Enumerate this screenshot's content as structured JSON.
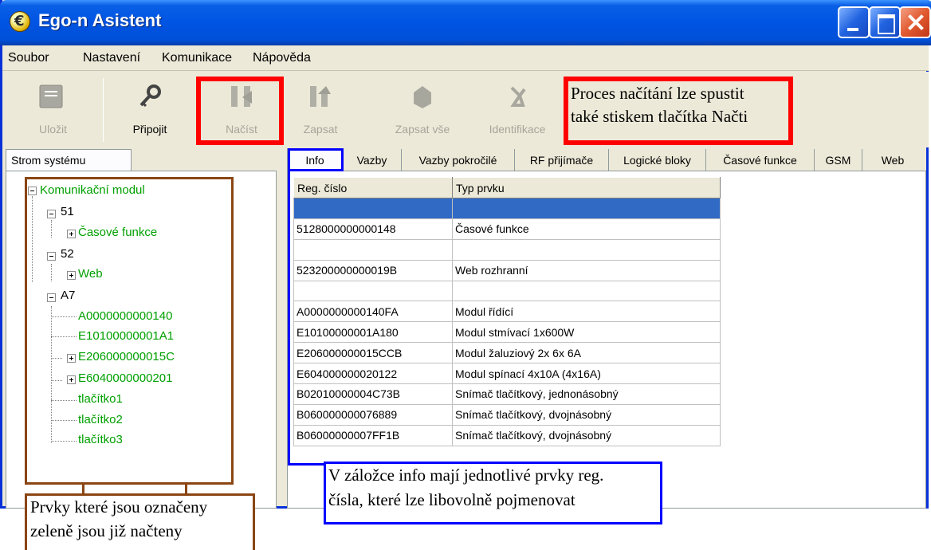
{
  "window": {
    "title": "Ego-n Asistent"
  },
  "menu": {
    "items": [
      "Soubor",
      "Nastavení",
      "Komunikace",
      "Nápověda"
    ]
  },
  "toolbar": {
    "save": "Uložit",
    "connect": "Připojit",
    "read": "Načíst",
    "write": "Zapsat",
    "write_all": "Zapsat vše",
    "identify": "Identifikace"
  },
  "left_tab": "Strom systému",
  "tree": {
    "root": "Komunikační modul",
    "n51": "51",
    "n51_child": "Časové funkce",
    "n52": "52",
    "n52_child": "Web",
    "nA7": "A7",
    "a1": "A0000000000140",
    "a2": "E10100000001A1",
    "a3": "E206000000015C",
    "a4": "E6040000000201",
    "a5": "tlačítko1",
    "a6": "tlačítko2",
    "a7": "tlačítko3"
  },
  "tabs": [
    "Info",
    "Vazby",
    "Vazby pokročilé",
    "RF přijímače",
    "Logické bloky",
    "Časové funkce",
    "GSM",
    "Web"
  ],
  "table": {
    "headers": [
      "Reg. číslo",
      "Typ prvku"
    ],
    "rows": [
      [
        "",
        ""
      ],
      [
        "5128000000000148",
        "Časové funkce"
      ],
      [
        "",
        ""
      ],
      [
        "523200000000019B",
        "Web rozhranní"
      ],
      [
        "",
        ""
      ],
      [
        "A0000000000140FA",
        "Modul řídící"
      ],
      [
        "E10100000001A180",
        "Modul stmívací 1x600W"
      ],
      [
        "E206000000015CCB",
        "Modul žaluziový 2x 6x 6A"
      ],
      [
        "E604000000020122",
        "Modul spínací 4x10A (4x16A)"
      ],
      [
        "B02010000004C73B",
        "Snímač tlačítkový, jednonásobný"
      ],
      [
        "B060000000076889",
        "Snímač tlačítkový, dvojnásobný"
      ],
      [
        "B06000000007FF1B",
        "Snímač tlačítkový, dvojnásobný"
      ]
    ]
  },
  "annotations": {
    "red_line1": "Proces načítání lze spustit",
    "red_line2": "také stiskem tlačítka Načti",
    "blue_line1": "V záložce info mají jednotlivé prvky reg.",
    "blue_line2": "čísla, které lze libovolně pojmenovat",
    "brown_line1": "Prvky které jsou označeny",
    "brown_line2": "zeleně jsou již načteny"
  },
  "colors": {
    "title_bar": "#0054e3",
    "tree_loaded": "#00a000",
    "selection": "#316ac5",
    "annotation_red": "#ff0000",
    "annotation_blue": "#0000ff",
    "annotation_brown": "#8b4513"
  }
}
